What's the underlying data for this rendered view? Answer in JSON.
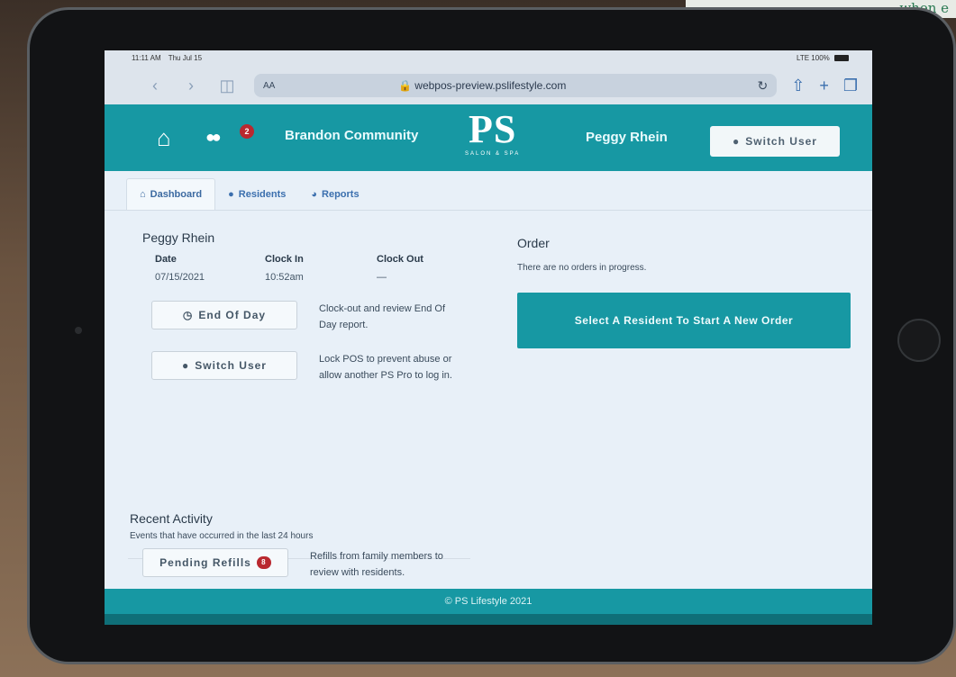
{
  "background": {
    "paper_text": "when e"
  },
  "statusbar": {
    "time": "11:11 AM",
    "date": "Thu Jul 15",
    "signal": "LTE 100%"
  },
  "browser": {
    "text_size_label": "AA",
    "url": "webpos-preview.pslifestyle.com"
  },
  "header": {
    "badge_count": "2",
    "community": "Brandon Community",
    "logo_text": "PS",
    "logo_sub": "SALON & SPA",
    "user_name": "Peggy Rhein",
    "switch_user_label": "Switch User"
  },
  "tabs": [
    {
      "label": "Dashboard",
      "active": true
    },
    {
      "label": "Residents",
      "active": false
    },
    {
      "label": "Reports",
      "active": false
    }
  ],
  "timecard": {
    "name": "Peggy Rhein",
    "date_header": "Date",
    "clockin_header": "Clock In",
    "clockout_header": "Clock Out",
    "date_value": "07/15/2021",
    "clockin_value": "10:52am",
    "clockout_value": "—"
  },
  "actions": {
    "end_of_day_label": "End Of Day",
    "end_of_day_desc": "Clock-out and review End Of Day report.",
    "switch_user_label": "Switch User",
    "switch_user_desc": "Lock POS to prevent abuse or allow another PS Pro to log in."
  },
  "recent": {
    "title": "Recent Activity",
    "subtitle": "Events that have occurred in the last 24 hours",
    "pending_refills_label": "Pending Refills",
    "pending_refills_count": "8",
    "pending_refills_desc": "Refills from family members to review with residents."
  },
  "order": {
    "title": "Order",
    "empty_text": "There are no orders in progress.",
    "start_button": "Select A Resident To Start A New Order"
  },
  "footer": {
    "text": "© PS Lifestyle 2021"
  },
  "colors": {
    "brand": "#1798a3",
    "badge": "#b9282f",
    "link": "#3b6fae"
  }
}
